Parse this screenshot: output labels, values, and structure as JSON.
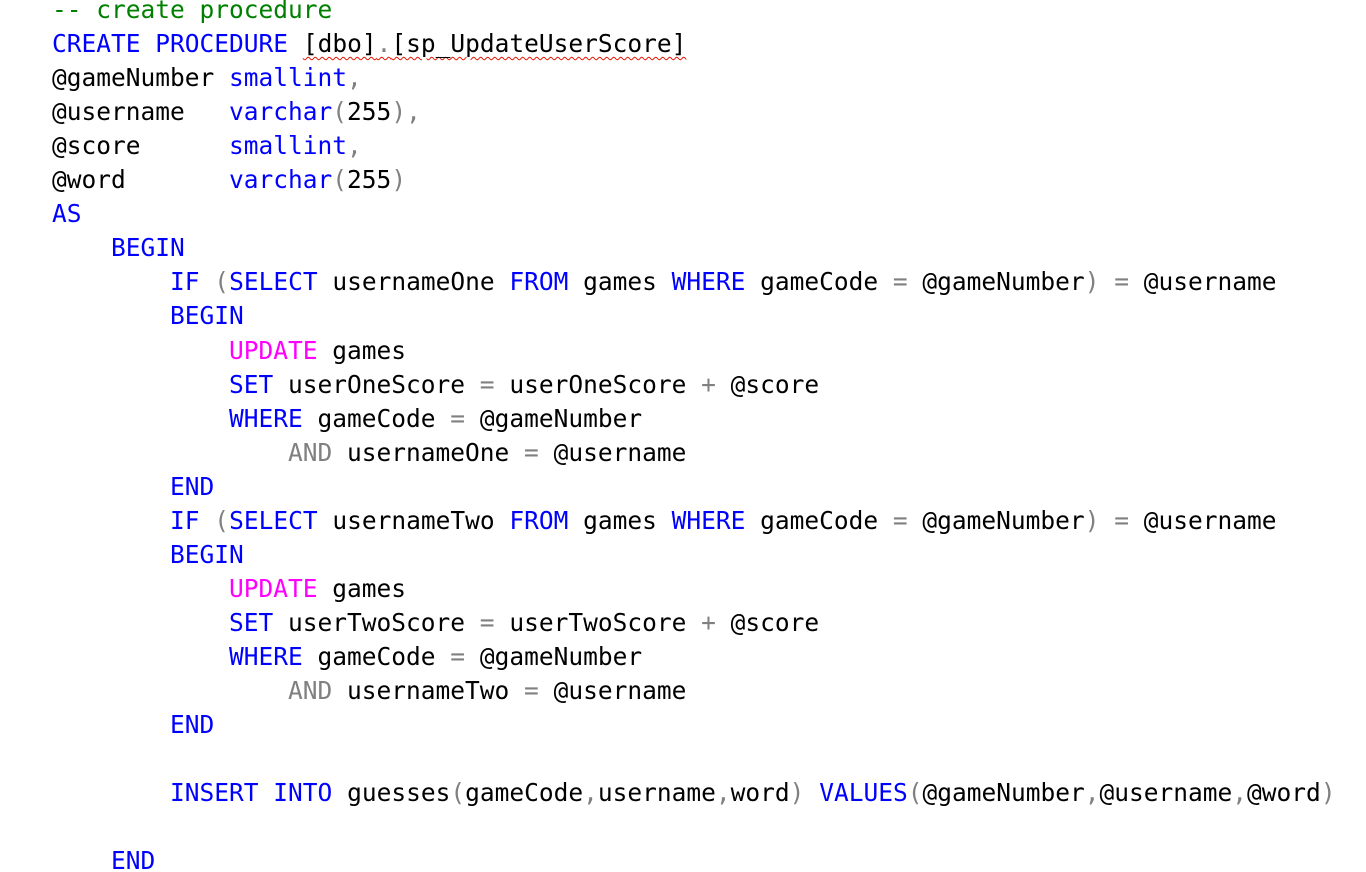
{
  "editor": {
    "lines": [
      {
        "indent": "",
        "tokens": [
          {
            "c": "cmt",
            "t": "-- create procedure"
          }
        ]
      },
      {
        "indent": "",
        "tokens": [
          {
            "c": "kw",
            "t": "CREATE"
          },
          {
            "c": "txt",
            "t": " "
          },
          {
            "c": "kw",
            "t": "PROCEDURE"
          },
          {
            "c": "txt",
            "t": " "
          },
          {
            "c": "txt",
            "t": "[dbo]",
            "sq": true
          },
          {
            "c": "op",
            "t": ".",
            "sq": true
          },
          {
            "c": "txt",
            "t": "[sp_UpdateUserScore]",
            "sq": true
          }
        ]
      },
      {
        "indent": "",
        "tokens": [
          {
            "c": "txt",
            "t": "@gameNumber "
          },
          {
            "c": "kw",
            "t": "smallint"
          },
          {
            "c": "op",
            "t": ","
          }
        ]
      },
      {
        "indent": "",
        "tokens": [
          {
            "c": "txt",
            "t": "@username   "
          },
          {
            "c": "kw",
            "t": "varchar"
          },
          {
            "c": "op",
            "t": "("
          },
          {
            "c": "txt",
            "t": "255"
          },
          {
            "c": "op",
            "t": "),"
          }
        ]
      },
      {
        "indent": "",
        "tokens": [
          {
            "c": "txt",
            "t": "@score      "
          },
          {
            "c": "kw",
            "t": "smallint"
          },
          {
            "c": "op",
            "t": ","
          }
        ]
      },
      {
        "indent": "",
        "tokens": [
          {
            "c": "txt",
            "t": "@word       "
          },
          {
            "c": "kw",
            "t": "varchar"
          },
          {
            "c": "op",
            "t": "("
          },
          {
            "c": "txt",
            "t": "255"
          },
          {
            "c": "op",
            "t": ")"
          }
        ]
      },
      {
        "indent": "",
        "tokens": [
          {
            "c": "kw",
            "t": "AS"
          }
        ]
      },
      {
        "indent": "    ",
        "tokens": [
          {
            "c": "kw",
            "t": "BEGIN"
          }
        ]
      },
      {
        "indent": "        ",
        "tokens": [
          {
            "c": "kw",
            "t": "IF"
          },
          {
            "c": "txt",
            "t": " "
          },
          {
            "c": "op",
            "t": "("
          },
          {
            "c": "kw",
            "t": "SELECT"
          },
          {
            "c": "txt",
            "t": " usernameOne "
          },
          {
            "c": "kw",
            "t": "FROM"
          },
          {
            "c": "txt",
            "t": " games "
          },
          {
            "c": "kw",
            "t": "WHERE"
          },
          {
            "c": "txt",
            "t": " gameCode "
          },
          {
            "c": "op",
            "t": "="
          },
          {
            "c": "txt",
            "t": " @gameNumber"
          },
          {
            "c": "op",
            "t": ")"
          },
          {
            "c": "txt",
            "t": " "
          },
          {
            "c": "op",
            "t": "="
          },
          {
            "c": "txt",
            "t": " @username"
          }
        ]
      },
      {
        "indent": "        ",
        "tokens": [
          {
            "c": "kw",
            "t": "BEGIN"
          }
        ]
      },
      {
        "indent": "            ",
        "tokens": [
          {
            "c": "dml",
            "t": "UPDATE"
          },
          {
            "c": "txt",
            "t": " games"
          }
        ]
      },
      {
        "indent": "            ",
        "tokens": [
          {
            "c": "kw",
            "t": "SET"
          },
          {
            "c": "txt",
            "t": " userOneScore "
          },
          {
            "c": "op",
            "t": "="
          },
          {
            "c": "txt",
            "t": " userOneScore "
          },
          {
            "c": "op",
            "t": "+"
          },
          {
            "c": "txt",
            "t": " @score"
          }
        ]
      },
      {
        "indent": "            ",
        "tokens": [
          {
            "c": "kw",
            "t": "WHERE"
          },
          {
            "c": "txt",
            "t": " gameCode "
          },
          {
            "c": "op",
            "t": "="
          },
          {
            "c": "txt",
            "t": " @gameNumber"
          }
        ]
      },
      {
        "indent": "                ",
        "tokens": [
          {
            "c": "op",
            "t": "AND"
          },
          {
            "c": "txt",
            "t": " usernameOne "
          },
          {
            "c": "op",
            "t": "="
          },
          {
            "c": "txt",
            "t": " @username"
          }
        ]
      },
      {
        "indent": "        ",
        "tokens": [
          {
            "c": "kw",
            "t": "END"
          }
        ]
      },
      {
        "indent": "        ",
        "tokens": [
          {
            "c": "kw",
            "t": "IF"
          },
          {
            "c": "txt",
            "t": " "
          },
          {
            "c": "op",
            "t": "("
          },
          {
            "c": "kw",
            "t": "SELECT"
          },
          {
            "c": "txt",
            "t": " usernameTwo "
          },
          {
            "c": "kw",
            "t": "FROM"
          },
          {
            "c": "txt",
            "t": " games "
          },
          {
            "c": "kw",
            "t": "WHERE"
          },
          {
            "c": "txt",
            "t": " gameCode "
          },
          {
            "c": "op",
            "t": "="
          },
          {
            "c": "txt",
            "t": " @gameNumber"
          },
          {
            "c": "op",
            "t": ")"
          },
          {
            "c": "txt",
            "t": " "
          },
          {
            "c": "op",
            "t": "="
          },
          {
            "c": "txt",
            "t": " @username"
          }
        ]
      },
      {
        "indent": "        ",
        "tokens": [
          {
            "c": "kw",
            "t": "BEGIN"
          }
        ]
      },
      {
        "indent": "            ",
        "tokens": [
          {
            "c": "dml",
            "t": "UPDATE"
          },
          {
            "c": "txt",
            "t": " games"
          }
        ]
      },
      {
        "indent": "            ",
        "tokens": [
          {
            "c": "kw",
            "t": "SET"
          },
          {
            "c": "txt",
            "t": " userTwoScore "
          },
          {
            "c": "op",
            "t": "="
          },
          {
            "c": "txt",
            "t": " userTwoScore "
          },
          {
            "c": "op",
            "t": "+"
          },
          {
            "c": "txt",
            "t": " @score"
          }
        ]
      },
      {
        "indent": "            ",
        "tokens": [
          {
            "c": "kw",
            "t": "WHERE"
          },
          {
            "c": "txt",
            "t": " gameCode "
          },
          {
            "c": "op",
            "t": "="
          },
          {
            "c": "txt",
            "t": " @gameNumber"
          }
        ]
      },
      {
        "indent": "                ",
        "tokens": [
          {
            "c": "op",
            "t": "AND"
          },
          {
            "c": "txt",
            "t": " usernameTwo "
          },
          {
            "c": "op",
            "t": "="
          },
          {
            "c": "txt",
            "t": " @username"
          }
        ]
      },
      {
        "indent": "        ",
        "tokens": [
          {
            "c": "kw",
            "t": "END"
          }
        ]
      },
      {
        "indent": "",
        "tokens": []
      },
      {
        "indent": "        ",
        "tokens": [
          {
            "c": "kw",
            "t": "INSERT"
          },
          {
            "c": "txt",
            "t": " "
          },
          {
            "c": "kw",
            "t": "INTO"
          },
          {
            "c": "txt",
            "t": " guesses"
          },
          {
            "c": "op",
            "t": "("
          },
          {
            "c": "txt",
            "t": "gameCode"
          },
          {
            "c": "op",
            "t": ","
          },
          {
            "c": "txt",
            "t": "username"
          },
          {
            "c": "op",
            "t": ","
          },
          {
            "c": "txt",
            "t": "word"
          },
          {
            "c": "op",
            "t": ")"
          },
          {
            "c": "txt",
            "t": " "
          },
          {
            "c": "kw",
            "t": "VALUES"
          },
          {
            "c": "op",
            "t": "("
          },
          {
            "c": "txt",
            "t": "@gameNumber"
          },
          {
            "c": "op",
            "t": ","
          },
          {
            "c": "txt",
            "t": "@username"
          },
          {
            "c": "op",
            "t": ","
          },
          {
            "c": "txt",
            "t": "@word"
          },
          {
            "c": "op",
            "t": ")"
          }
        ]
      },
      {
        "indent": "",
        "tokens": []
      },
      {
        "indent": "    ",
        "tokens": [
          {
            "c": "kw",
            "t": "END"
          }
        ]
      }
    ]
  },
  "colors": {
    "keyword": "#0000ff",
    "dml_keyword": "#ff00ff",
    "operator": "#808080",
    "comment": "#008000",
    "text": "#000000",
    "error_squiggle": "#e51400",
    "background": "#ffffff"
  }
}
